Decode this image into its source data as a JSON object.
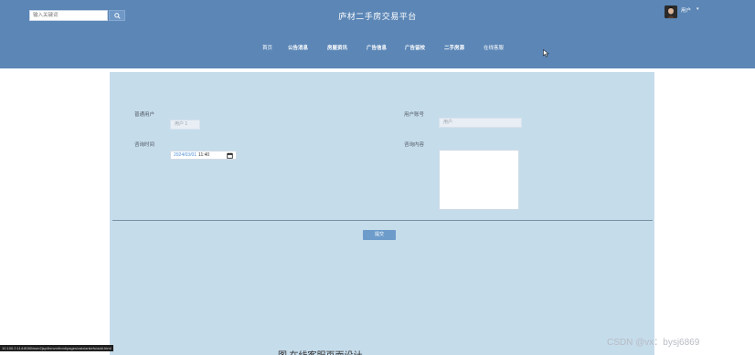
{
  "header": {
    "search_placeholder": "输入关键词",
    "site_title": "庐材二手房交易平台",
    "user_name": "用户"
  },
  "nav": {
    "items": [
      {
        "label": "首页",
        "bold": false
      },
      {
        "label": "公告消息",
        "bold": true
      },
      {
        "label": "房屋资讯",
        "bold": true
      },
      {
        "label": "广告信息",
        "bold": true
      },
      {
        "label": "广告留校",
        "bold": true
      },
      {
        "label": "二手房源",
        "bold": true
      },
      {
        "label": "在线客服",
        "bold": false
      }
    ]
  },
  "form": {
    "user_label": "普通用户",
    "user_value": "用户 1",
    "account_label": "用户账号",
    "account_value": "用户",
    "time_label": "咨询时间",
    "date_value": "2024/03/01",
    "time_value": "11:40",
    "content_label": "咨询内容",
    "submit_label": "提交"
  },
  "footer": {
    "status_url": "10.100.2.114:8080/ssm2jsp4hmvn/front/pages/zaixiankefu/add.html",
    "watermark": "CSDN @vx：bysj6869",
    "caption": "图          在线客服页面设计"
  },
  "colors": {
    "header_bg": "#5b86b6",
    "panel_bg": "#c5dceb",
    "button_bg": "#6d9ccb"
  }
}
